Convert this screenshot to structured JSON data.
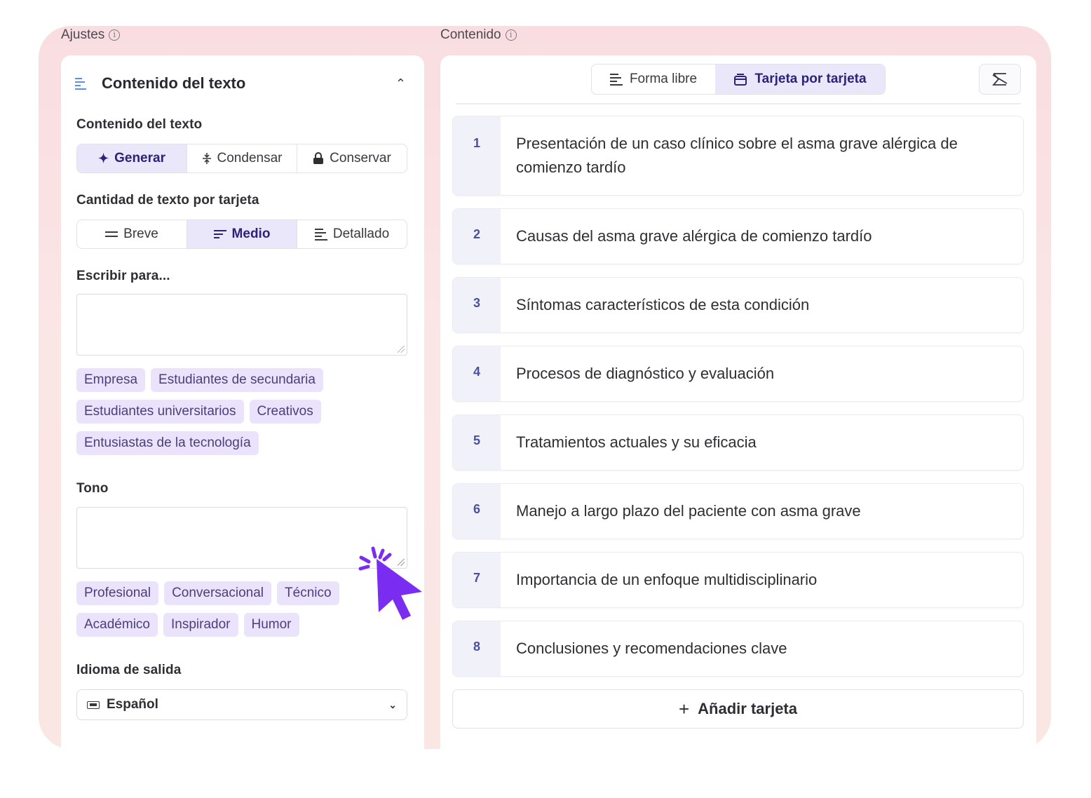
{
  "left": {
    "section_label": "Ajustes",
    "panel_title": "Contenido del texto",
    "content_label": "Contenido del texto",
    "content_options": [
      "Generar",
      "Condensar",
      "Conservar"
    ],
    "content_selected": "Generar",
    "amount_label": "Cantidad de texto por tarjeta",
    "amount_options": [
      "Breve",
      "Medio",
      "Detallado"
    ],
    "amount_selected": "Medio",
    "audience_label": "Escribir para...",
    "audience_value": "",
    "audience_chips": [
      "Empresa",
      "Estudiantes de secundaria",
      "Estudiantes universitarios",
      "Creativos",
      "Entusiastas de la tecnología"
    ],
    "tone_label": "Tono",
    "tone_value": "",
    "tone_chips": [
      "Profesional",
      "Conversacional",
      "Técnico",
      "Académico",
      "Inspirador",
      "Humor"
    ],
    "language_label": "Idioma de salida",
    "language_value": "Español"
  },
  "right": {
    "section_label": "Contenido",
    "modes": [
      "Forma libre",
      "Tarjeta por tarjeta"
    ],
    "mode_selected": "Tarjeta por tarjeta",
    "cards": [
      {
        "number": "1",
        "text": "Presentación de un caso clínico sobre el asma grave alérgica de comienzo tardío"
      },
      {
        "number": "2",
        "text": "Causas del asma grave alérgica de comienzo tardío"
      },
      {
        "number": "3",
        "text": "Síntomas característicos de esta condición"
      },
      {
        "number": "4",
        "text": "Procesos de diagnóstico y evaluación"
      },
      {
        "number": "5",
        "text": "Tratamientos actuales y su eficacia"
      },
      {
        "number": "6",
        "text": "Manejo a largo plazo del paciente con asma grave"
      },
      {
        "number": "7",
        "text": "Importancia de un enfoque multidisciplinario"
      },
      {
        "number": "8",
        "text": "Conclusiones y recomendaciones clave"
      }
    ],
    "add_card_label": "Añadir tarjeta"
  },
  "colors": {
    "accent": "#2b237a",
    "active_bg": "#ebe7fb",
    "chip_bg": "#ebe3fb",
    "cursor": "#7a2cf0",
    "frame_bg": "#f9dde1"
  }
}
